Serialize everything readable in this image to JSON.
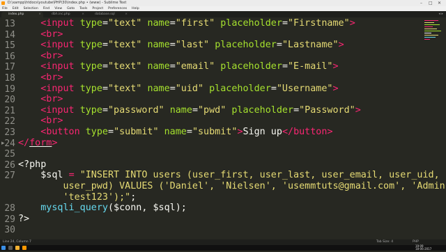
{
  "window": {
    "title": "D:\\xampp\\htdocs\\youtube\\PHP\\30\\index.php • (www) - Sublime Text",
    "controls": [
      "–",
      "□",
      "✕"
    ]
  },
  "menu": [
    "File",
    "Edit",
    "Selection",
    "Find",
    "View",
    "Goto",
    "Tools",
    "Project",
    "Preferences",
    "Help"
  ],
  "tabs": [
    {
      "label": "index.php",
      "active": true
    },
    {
      "label": "dbh.inc.php",
      "active": false
    },
    {
      "label": "database.sql",
      "active": false
    }
  ],
  "editor": {
    "current_line": 24,
    "lines": [
      {
        "num": "13",
        "tokens": [
          [
            "",
            "    "
          ],
          [
            "t",
            "<input"
          ],
          [
            "v",
            " "
          ],
          [
            "a",
            "type"
          ],
          [
            "v",
            "="
          ],
          [
            "s",
            "\"text\""
          ],
          [
            "v",
            " "
          ],
          [
            "a",
            "name"
          ],
          [
            "v",
            "="
          ],
          [
            "s",
            "\"first\""
          ],
          [
            "v",
            " "
          ],
          [
            "a",
            "placeholder"
          ],
          [
            "v",
            "="
          ],
          [
            "s",
            "\"Firstname\""
          ],
          [
            "t",
            ">"
          ]
        ]
      },
      {
        "num": "14",
        "tokens": [
          [
            "",
            "    "
          ],
          [
            "t",
            "<br>"
          ]
        ]
      },
      {
        "num": "15",
        "tokens": [
          [
            "",
            "    "
          ],
          [
            "t",
            "<input"
          ],
          [
            "v",
            " "
          ],
          [
            "a",
            "type"
          ],
          [
            "v",
            "="
          ],
          [
            "s",
            "\"text\""
          ],
          [
            "v",
            " "
          ],
          [
            "a",
            "name"
          ],
          [
            "v",
            "="
          ],
          [
            "s",
            "\"last\""
          ],
          [
            "v",
            " "
          ],
          [
            "a",
            "placeholder"
          ],
          [
            "v",
            "="
          ],
          [
            "s",
            "\"Lastname\""
          ],
          [
            "t",
            ">"
          ]
        ]
      },
      {
        "num": "16",
        "tokens": [
          [
            "",
            "    "
          ],
          [
            "t",
            "<br>"
          ]
        ]
      },
      {
        "num": "17",
        "tokens": [
          [
            "",
            "    "
          ],
          [
            "t",
            "<input"
          ],
          [
            "v",
            " "
          ],
          [
            "a",
            "type"
          ],
          [
            "v",
            "="
          ],
          [
            "s",
            "\"text\""
          ],
          [
            "v",
            " "
          ],
          [
            "a",
            "name"
          ],
          [
            "v",
            "="
          ],
          [
            "s",
            "\"email\""
          ],
          [
            "v",
            " "
          ],
          [
            "a",
            "placeholder"
          ],
          [
            "v",
            "="
          ],
          [
            "s",
            "\"E-mail\""
          ],
          [
            "t",
            ">"
          ]
        ]
      },
      {
        "num": "18",
        "tokens": [
          [
            "",
            "    "
          ],
          [
            "t",
            "<br>"
          ]
        ]
      },
      {
        "num": "19",
        "tokens": [
          [
            "",
            "    "
          ],
          [
            "t",
            "<input"
          ],
          [
            "v",
            " "
          ],
          [
            "a",
            "type"
          ],
          [
            "v",
            "="
          ],
          [
            "s",
            "\"text\""
          ],
          [
            "v",
            " "
          ],
          [
            "a",
            "name"
          ],
          [
            "v",
            "="
          ],
          [
            "s",
            "\"uid\""
          ],
          [
            "v",
            " "
          ],
          [
            "a",
            "placeholder"
          ],
          [
            "v",
            "="
          ],
          [
            "s",
            "\"Username\""
          ],
          [
            "t",
            ">"
          ]
        ]
      },
      {
        "num": "20",
        "tokens": [
          [
            "",
            "    "
          ],
          [
            "t",
            "<br>"
          ]
        ]
      },
      {
        "num": "21",
        "tokens": [
          [
            "",
            "    "
          ],
          [
            "t",
            "<input"
          ],
          [
            "v",
            " "
          ],
          [
            "a",
            "type"
          ],
          [
            "v",
            "="
          ],
          [
            "s",
            "\"password\""
          ],
          [
            "v",
            " "
          ],
          [
            "a",
            "name"
          ],
          [
            "v",
            "="
          ],
          [
            "s",
            "\"pwd\""
          ],
          [
            "v",
            " "
          ],
          [
            "a",
            "placeholder"
          ],
          [
            "v",
            "="
          ],
          [
            "s",
            "\"Password\""
          ],
          [
            "t",
            ">"
          ]
        ]
      },
      {
        "num": "22",
        "tokens": [
          [
            "",
            "    "
          ],
          [
            "t",
            "<br>"
          ]
        ]
      },
      {
        "num": "23",
        "tokens": [
          [
            "",
            "    "
          ],
          [
            "t",
            "<"
          ],
          [
            "t",
            "button"
          ],
          [
            "v",
            " "
          ],
          [
            "a",
            "type"
          ],
          [
            "v",
            "="
          ],
          [
            "s",
            "\"submit\""
          ],
          [
            "v",
            " "
          ],
          [
            "a",
            "name"
          ],
          [
            "v",
            "="
          ],
          [
            "s",
            "\"submit\""
          ],
          [
            "t",
            ">"
          ],
          [
            "v",
            "Sign up"
          ],
          [
            "t",
            "</"
          ],
          [
            "t",
            "button"
          ],
          [
            "t",
            ">"
          ]
        ]
      },
      {
        "num": "24",
        "tokens": [
          [
            "",
            ""
          ],
          [
            "t",
            "</"
          ],
          [
            "tu",
            "form"
          ],
          [
            "t",
            ">"
          ]
        ]
      },
      {
        "num": "25",
        "tokens": []
      },
      {
        "num": "26",
        "tokens": [
          [
            "",
            ""
          ],
          [
            "v",
            "<?php"
          ]
        ]
      },
      {
        "num": "27",
        "tokens": [
          [
            "",
            "    "
          ],
          [
            "v",
            "$sql "
          ],
          [
            "t",
            "="
          ],
          [
            "v",
            " "
          ],
          [
            "s",
            "\"INSERT INTO users (user_first, user_last, user_email, user_uid,"
          ]
        ]
      },
      {
        "num": "",
        "tokens": [
          [
            "",
            "        "
          ],
          [
            "s",
            "user_pwd) VALUES ('Daniel', 'Nielsen', 'usemmtuts@gmail.com', 'Admin',"
          ]
        ]
      },
      {
        "num": "",
        "tokens": [
          [
            "",
            "        "
          ],
          [
            "s",
            "'test123');\""
          ],
          [
            "v",
            ";"
          ]
        ]
      },
      {
        "num": "28",
        "tokens": [
          [
            "",
            "    "
          ],
          [
            "f",
            "mysqli_query"
          ],
          [
            "v",
            "($conn, $sql);"
          ]
        ]
      },
      {
        "num": "29",
        "tokens": [
          [
            "",
            ""
          ],
          [
            "v",
            "?>"
          ]
        ]
      },
      {
        "num": "30",
        "tokens": []
      }
    ]
  },
  "status": {
    "position": "Line 24, Column 7",
    "spaces": "Tab Size: 4",
    "syntax": "PHP"
  },
  "taskbar": {
    "time": "19:09",
    "date": "18-06-2017"
  },
  "colors": {
    "background": "#272822",
    "tag": "#f92672",
    "attribute": "#a6e22e",
    "string": "#e6db74",
    "function": "#66d9ef",
    "text": "#f8f8f2",
    "line_number": "#90908a"
  }
}
